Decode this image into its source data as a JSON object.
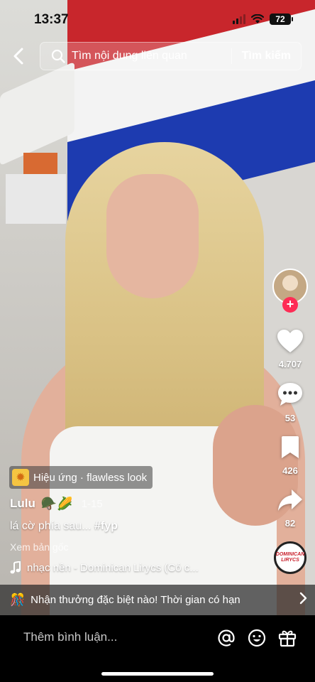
{
  "status_bar": {
    "time": "13:37",
    "battery": "72"
  },
  "search": {
    "placeholder": "Tìm nội dung liên quan",
    "button_label": "Tìm kiếm"
  },
  "rail": {
    "likes": "4.707",
    "comments": "53",
    "saves": "426",
    "shares": "82",
    "follow_symbol": "+",
    "music_disc_text": [
      "DOMINICAN",
      "LIRYCS"
    ]
  },
  "post": {
    "effect_label": "Hiệu ứng · flawless look",
    "author": "Lulu",
    "author_emojis": "🪖🌽",
    "date": "1-15",
    "caption_text": "lá cờ phía sau... ",
    "caption_hashtag": "#fyp",
    "see_original": "Xem bản gốc",
    "sound": "nhạc nền - Dominican Lirycs (Có c..."
  },
  "promo": {
    "icon": "🎊",
    "text": "Nhận thưởng đặc biệt nào! Thời gian có hạn"
  },
  "comment_bar": {
    "placeholder": "Thêm bình luận..."
  },
  "colors": {
    "accent_red": "#fe2c55",
    "comment_bar_bg": "#000000"
  }
}
